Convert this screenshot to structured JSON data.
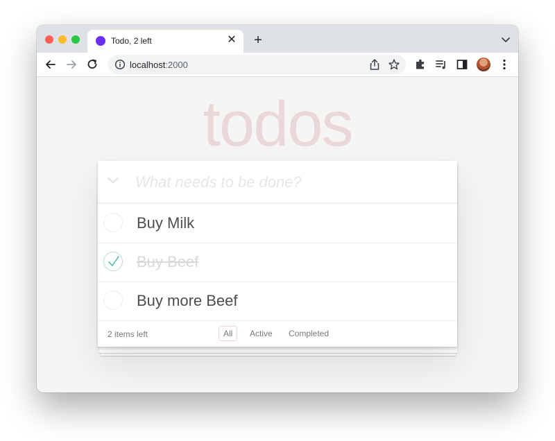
{
  "browser": {
    "tab_title": "Todo, 2 left",
    "url_host": "localhost",
    "url_port": ":2000"
  },
  "app": {
    "title": "todos",
    "new_todo_placeholder": "What needs to be done?",
    "todos": [
      {
        "label": "Buy Milk",
        "completed": false
      },
      {
        "label": "Buy Beef",
        "completed": true
      },
      {
        "label": "Buy more Beef",
        "completed": false
      }
    ],
    "footer": {
      "count_text": "2 items left",
      "filters": [
        "All",
        "Active",
        "Completed"
      ],
      "selected_filter": "All"
    }
  },
  "colors": {
    "accent": "#6a2ef4",
    "check": "#5dc2af",
    "title": "rgba(175,47,47,0.15)"
  }
}
